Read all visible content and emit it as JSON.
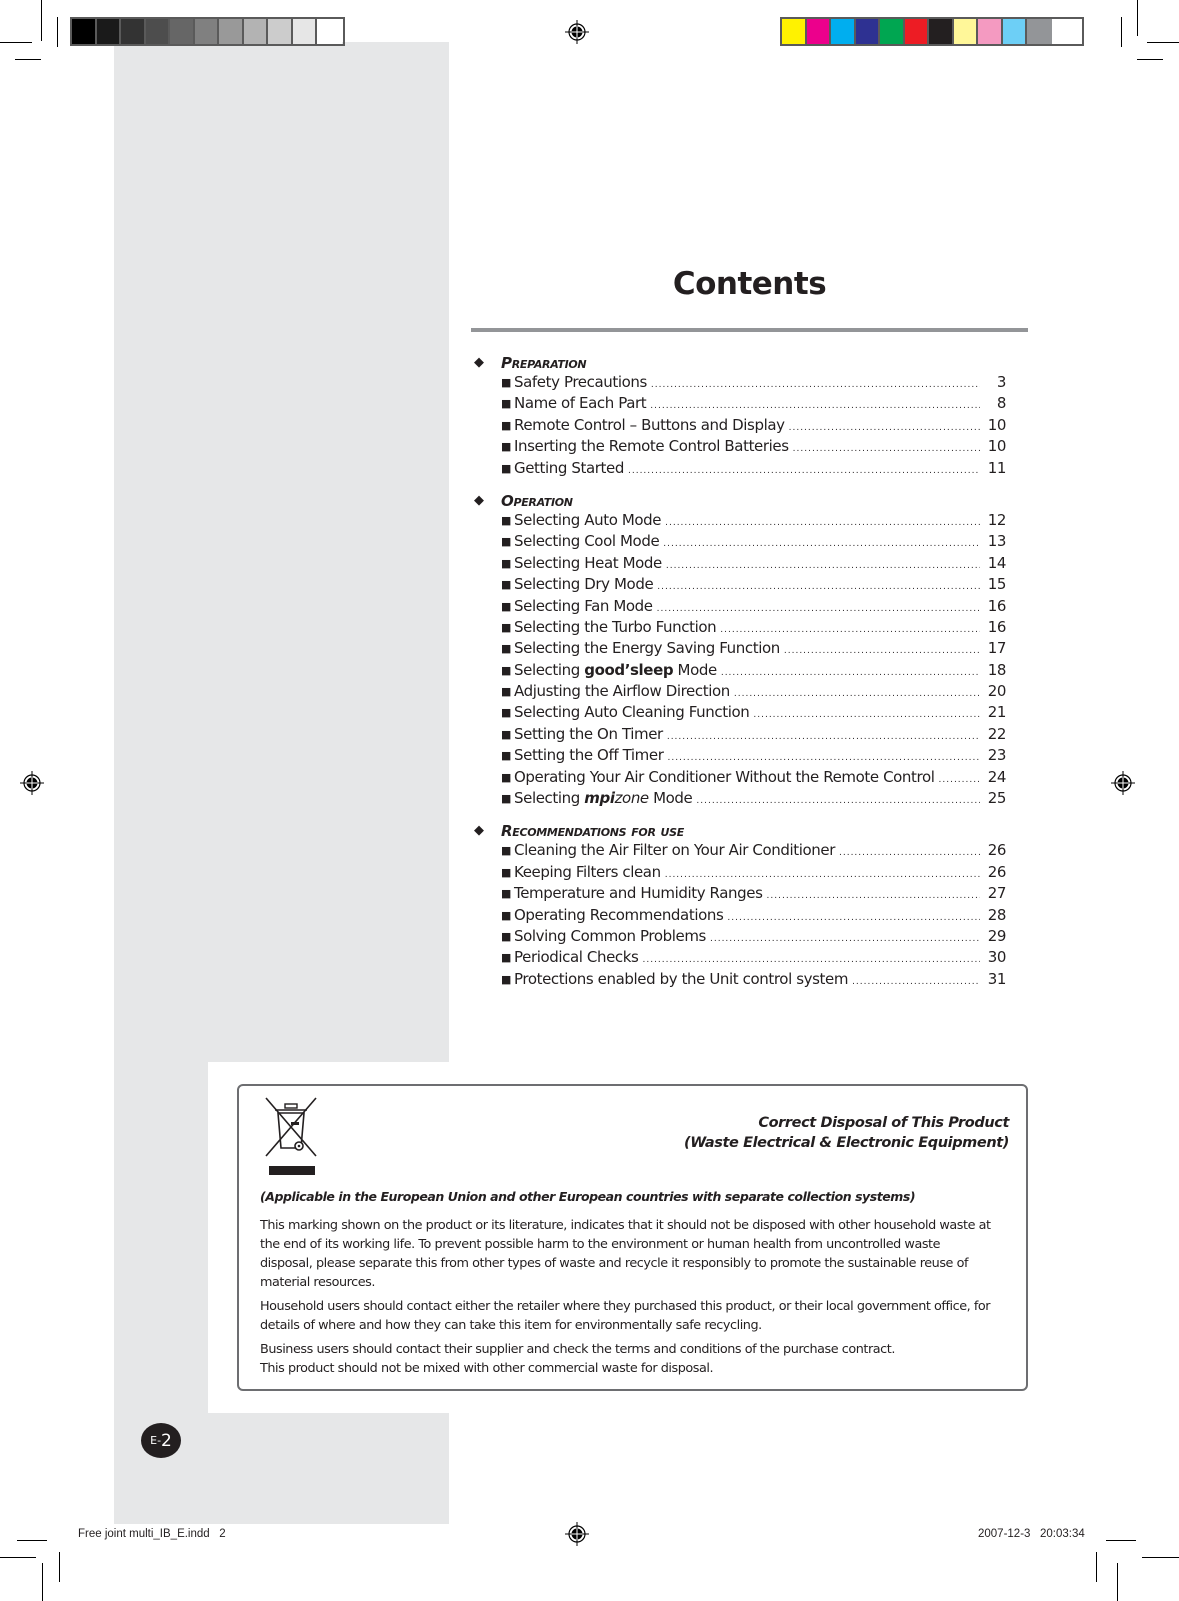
{
  "color_bars": {
    "grayscale": [
      "#000000",
      "#1a1a1a",
      "#333333",
      "#4d4d4d",
      "#666666",
      "#808080",
      "#999999",
      "#b3b3b3",
      "#cccccc",
      "#e6e6e6",
      "#ffffff"
    ],
    "process": [
      "#fff200",
      "#ec008c",
      "#00aeef",
      "#2e3192",
      "#00a651",
      "#ed1c24",
      "#231f20",
      "#fff799",
      "#f49ac1",
      "#6dcff6",
      "#939598"
    ]
  },
  "contents": {
    "title": "Contents",
    "sections": [
      {
        "heading": "Preparation",
        "items": [
          {
            "text": "Safety Precautions",
            "page": "3"
          },
          {
            "text": "Name of Each Part",
            "page": "8"
          },
          {
            "text": "Remote Control – Buttons and Display",
            "page": "10"
          },
          {
            "text": "Inserting the Remote Control Batteries",
            "page": "10"
          },
          {
            "text": "Getting Started",
            "page": "11"
          }
        ]
      },
      {
        "heading": "Operation",
        "items": [
          {
            "text": "Selecting Auto Mode",
            "page": "12"
          },
          {
            "text": "Selecting Cool Mode",
            "page": "13"
          },
          {
            "text": "Selecting Heat Mode",
            "page": "14"
          },
          {
            "text": "Selecting Dry Mode",
            "page": "15"
          },
          {
            "text": "Selecting Fan Mode",
            "page": "16"
          },
          {
            "text": "Selecting the Turbo Function",
            "page": "16"
          },
          {
            "text": "Selecting the Energy Saving Function",
            "page": "17"
          },
          {
            "text_pre": "Selecting ",
            "brand": "good’sleep",
            "text_post": " Mode",
            "page": "18"
          },
          {
            "text": "Adjusting the Airflow Direction",
            "page": "20"
          },
          {
            "text": "Selecting Auto Cleaning Function",
            "page": "21"
          },
          {
            "text": "Setting the On Timer",
            "page": "22"
          },
          {
            "text": "Setting the Off Timer",
            "page": "23"
          },
          {
            "text": "Operating Your Air Conditioner Without the Remote Control",
            "page": "24"
          },
          {
            "text_pre": "Selecting ",
            "brand_a": "mpi",
            "brand_b": "zone",
            "text_post": " Mode",
            "page": "25"
          }
        ]
      },
      {
        "heading": "Recommendations for use",
        "items": [
          {
            "text": "Cleaning the Air Filter on Your Air Conditioner",
            "page": "26"
          },
          {
            "text": "Keeping Filters clean",
            "page": "26"
          },
          {
            "text": "Temperature and Humidity Ranges",
            "page": "27"
          },
          {
            "text": "Operating Recommendations",
            "page": "28"
          },
          {
            "text": "Solving Common Problems",
            "page": "29"
          },
          {
            "text": "Periodical Checks",
            "page": "30"
          },
          {
            "text": "Protections enabled by the Unit control system",
            "page": "31"
          }
        ]
      }
    ]
  },
  "disposal": {
    "icon": "crossed-out-wheelie-bin-icon",
    "title_line1": "Correct Disposal of This Product",
    "title_line2": "(Waste Electrical & Electronic Equipment)",
    "applicability": "(Applicable in the European Union and other European countries with separate collection systems)",
    "paragraphs": [
      "This marking shown on the product or its literature, indicates that it should not be disposed with other household waste at the end of its working life. To prevent possible harm to the environment or human health from uncontrolled waste disposal, please separate this from other types of waste and recycle it responsibly to promote the sustainable reuse of material resources.",
      "Household users should contact either the retailer where they purchased this product, or their local government office, for details of where and how they can take this item for environmentally safe recycling.",
      "Business users should contact their supplier and check the terms and conditions of the purchase contract.\nThis product should not be mixed with other commercial waste for disposal."
    ]
  },
  "page_badge": {
    "prefix": "E-",
    "number": "2"
  },
  "slug": {
    "file": "Free joint multi_IB_E.indd   2",
    "timestamp": "2007-12-3   20:03:34"
  }
}
